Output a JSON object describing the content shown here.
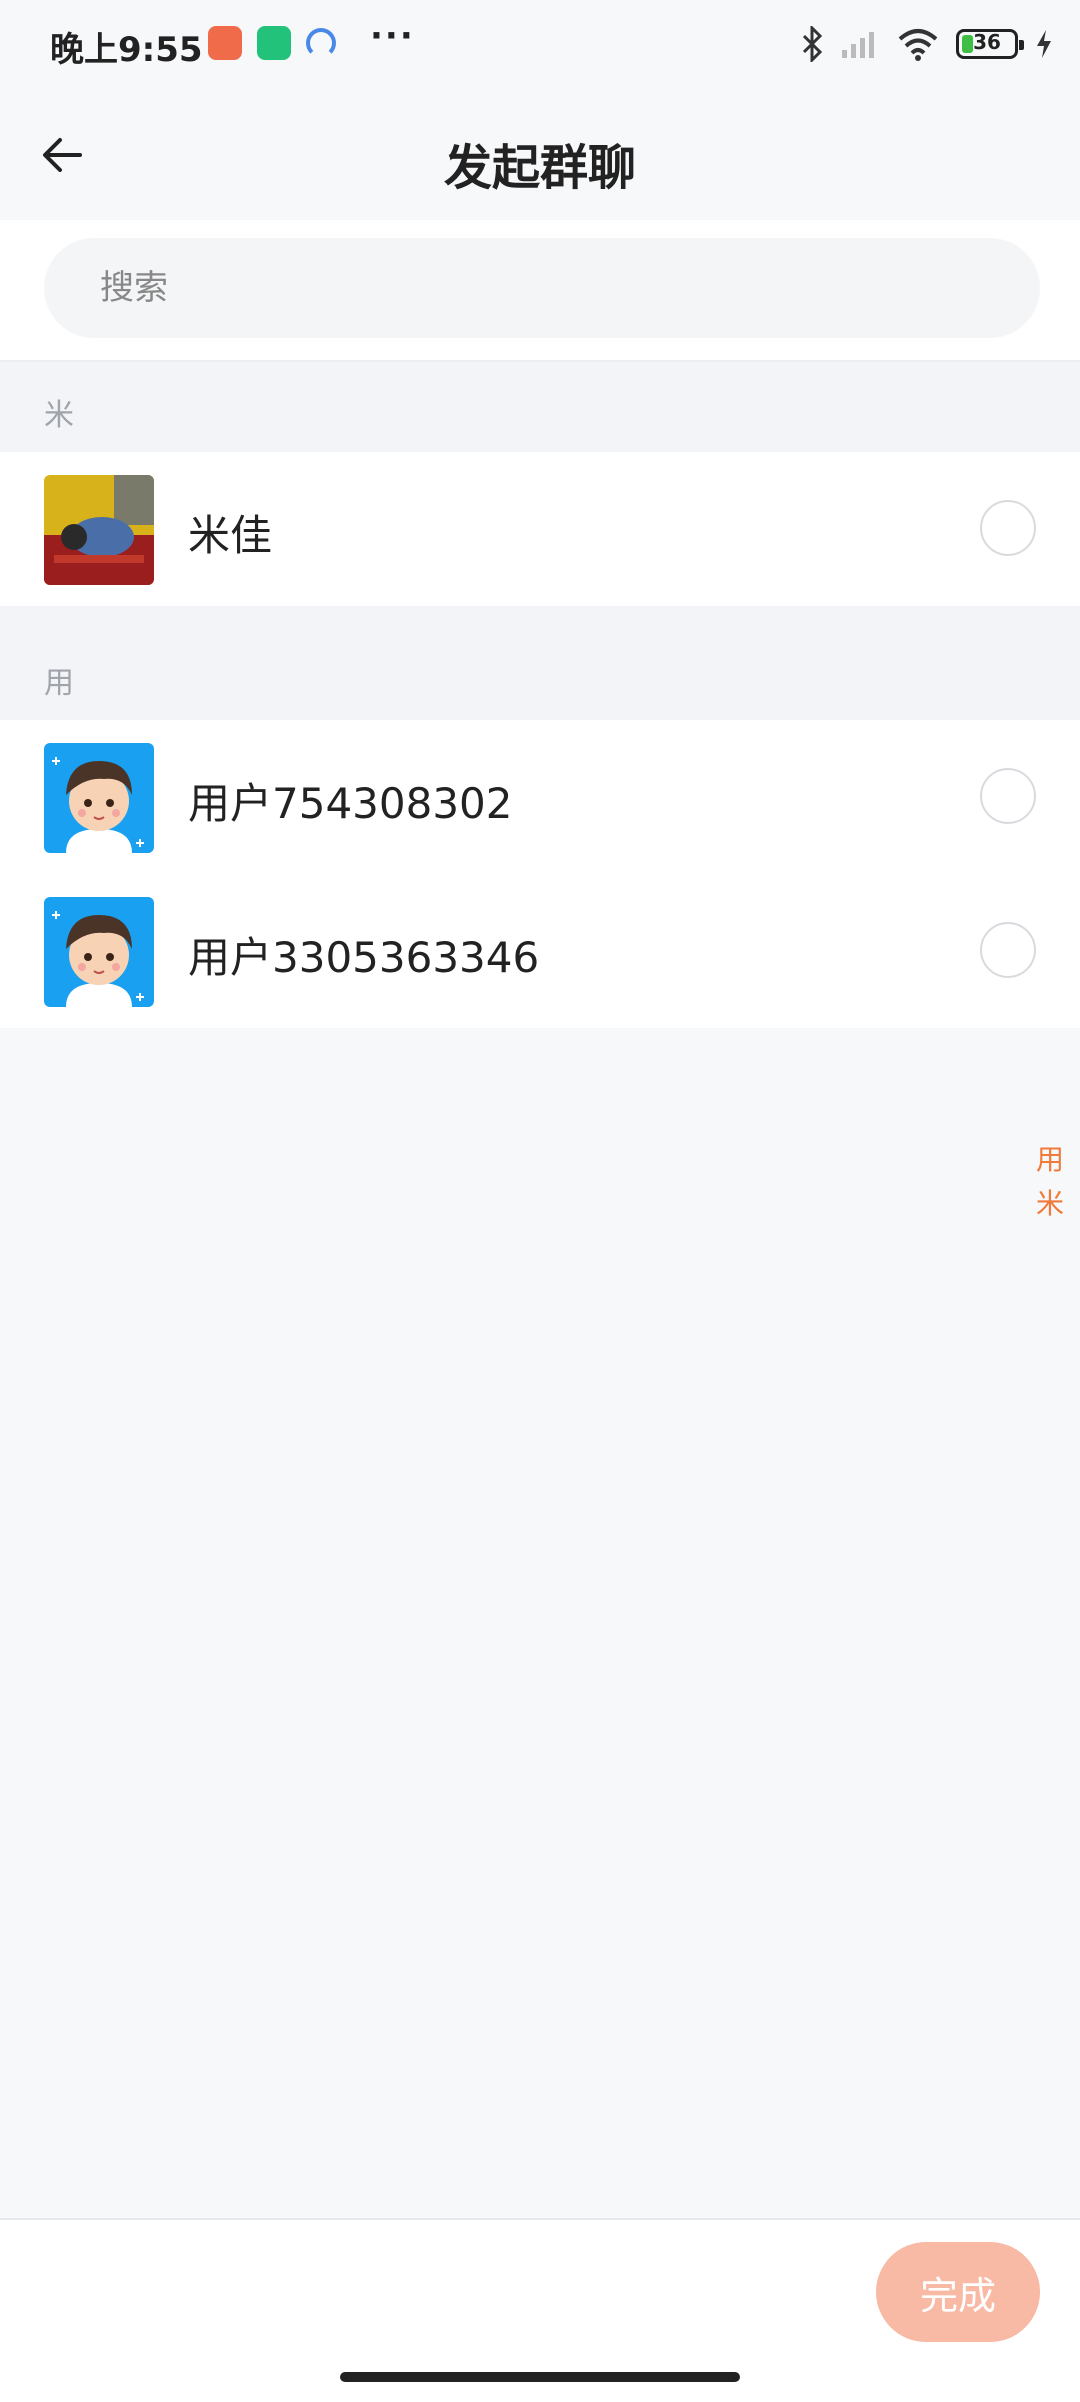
{
  "status_bar": {
    "time": "晚上9:55",
    "more": "···",
    "battery_level": "36",
    "battery_fraction": 0.36,
    "icons": [
      "app-notification-orange",
      "app-notification-green",
      "app-notification-blue",
      "bluetooth-icon",
      "signal-icon",
      "wifi-icon",
      "battery-icon",
      "charging-icon"
    ]
  },
  "header": {
    "title": "发起群聊",
    "back_icon": "arrow-left-icon"
  },
  "search": {
    "placeholder": "搜索"
  },
  "sections": [
    {
      "letter": "米",
      "contacts": [
        {
          "name": "米佳",
          "avatar": "photo",
          "selected": false
        }
      ]
    },
    {
      "letter": "用",
      "contacts": [
        {
          "name": "用户754308302",
          "avatar": "cartoon-boy",
          "selected": false
        },
        {
          "name": "用户3305363346",
          "avatar": "cartoon-boy",
          "selected": false
        }
      ]
    }
  ],
  "index_bar": [
    "用",
    "米"
  ],
  "bottom": {
    "done_label": "完成"
  },
  "colors": {
    "accent": "#f07a3a",
    "done_disabled": "#f8b9a5",
    "avatar_bg": "#1aa0f0"
  }
}
